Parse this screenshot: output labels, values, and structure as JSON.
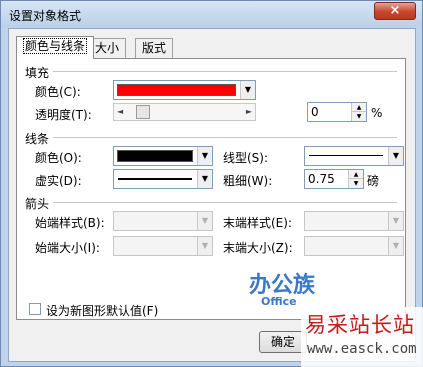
{
  "window": {
    "title": "设置对象格式",
    "close_symbol": "×"
  },
  "tabs": [
    {
      "label": "颜色与线条",
      "active": true
    },
    {
      "label": "大小",
      "active": false
    },
    {
      "label": "版式",
      "active": false
    }
  ],
  "fill": {
    "section_label": "填充",
    "color_label": "颜色(C):",
    "color_value": "#ff0000",
    "transparency_label": "透明度(T):",
    "transparency_value": "0",
    "transparency_unit": "%"
  },
  "line": {
    "section_label": "线条",
    "color_label": "颜色(O):",
    "color_value": "#000000",
    "dash_label": "虚实(D):",
    "style_label": "线型(S):",
    "weight_label": "粗细(W):",
    "weight_value": "0.75",
    "weight_unit": "磅"
  },
  "arrows": {
    "section_label": "箭头",
    "begin_style_label": "始端样式(B):",
    "begin_size_label": "始端大小(I):",
    "end_style_label": "末端样式(E):",
    "end_size_label": "末端大小(Z):"
  },
  "default_checkbox_label": "设为新图形默认值(F)",
  "ok_label": "确定",
  "watermark": {
    "logo_text": "办公族",
    "logo_sub": "Office",
    "site_name": "易采站长站",
    "url": "www.easck.com"
  },
  "icons": {
    "dropdown": "▼",
    "spin_up": "▲",
    "spin_down": "▼",
    "slider_left": "◄",
    "slider_right": "►"
  }
}
